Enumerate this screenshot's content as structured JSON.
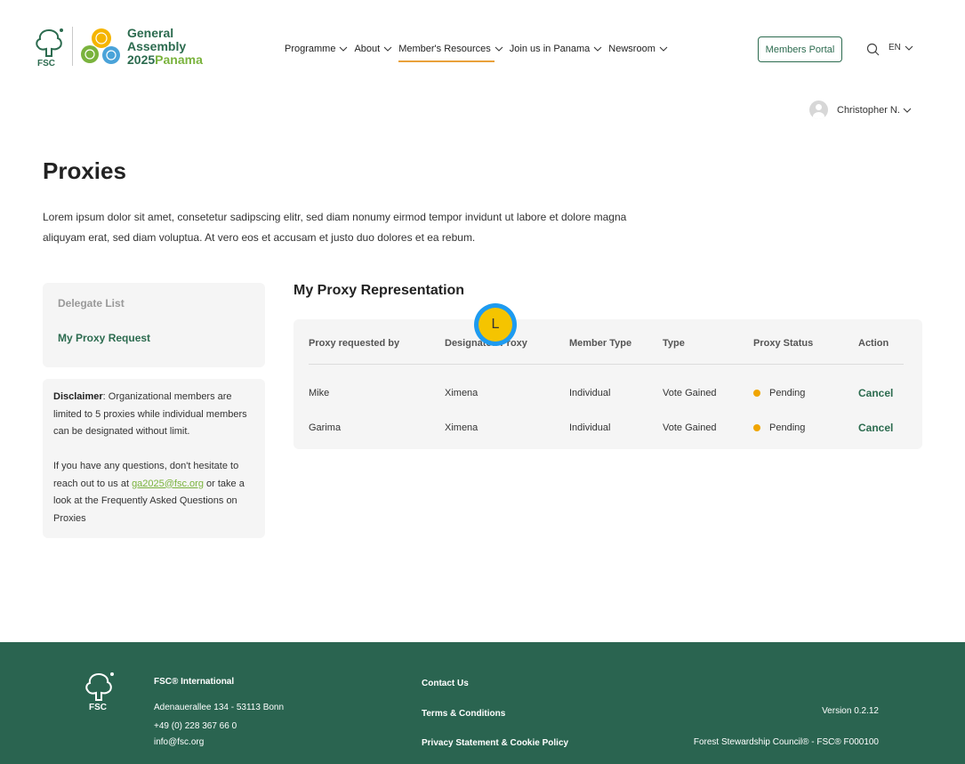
{
  "header": {
    "logo_text": "FSC",
    "ga_line1": "General",
    "ga_line2": "Assembly",
    "ga_year": "2025",
    "ga_place": "Panama",
    "nav": [
      {
        "label": "Programme",
        "icon": "chevron-down-icon"
      },
      {
        "label": "About",
        "icon": "chevron-down-icon"
      },
      {
        "label": "Member's Resources",
        "icon": "chevron-down-icon",
        "active": true
      },
      {
        "label": "Join us in Panama",
        "icon": "chevron-down-icon"
      },
      {
        "label": "Newsroom",
        "icon": "chevron-down-icon"
      }
    ],
    "members_portal": "Members Portal",
    "language": "EN",
    "user_name": "Christopher N."
  },
  "page": {
    "title": "Proxies",
    "description": "Lorem ipsum dolor sit amet, consetetur sadipscing elitr, sed diam nonumy eirmod tempor invidunt ut labore et dolore magna aliquyam erat, sed diam voluptua. At vero eos et accusam et justo duo dolores et ea rebum."
  },
  "sidebar": {
    "items": [
      {
        "label": "Delegate List"
      },
      {
        "label": "My Proxy Request"
      }
    ],
    "disclaimer_label": "Disclaimer",
    "disclaimer_text": ": Organizational members are limited to 5 proxies while individual members can be designated without limit.",
    "contact_prefix": "If you have any questions, don't hesitate to reach out to us at ",
    "contact_email": "ga2025@fsc.org",
    "contact_suffix": " or take a look at the Frequently Asked Questions on Proxies"
  },
  "table": {
    "title": "My Proxy Representation",
    "columns": [
      "Proxy requested by",
      "Designated Proxy",
      "Member Type",
      "Type",
      "Proxy Status",
      "Action"
    ],
    "rows": [
      {
        "requested_by": "Mike",
        "designated": "Ximena",
        "member_type": "Individual",
        "type": "Vote Gained",
        "status": "Pending",
        "action": "Cancel"
      },
      {
        "requested_by": "Garima",
        "designated": "Ximena",
        "member_type": "Individual",
        "type": "Vote Gained",
        "status": "Pending",
        "action": "Cancel"
      }
    ],
    "status_color": "#f0a500"
  },
  "cursor": {
    "label": "L"
  },
  "footer": {
    "org": "FSC® International",
    "address": "Adenauerallee 134 - 53113 Bonn",
    "phone": "+49 (0) 228 367 66 0",
    "email": "info@fsc.org",
    "links": [
      "Contact Us",
      "Terms & Conditions",
      "Privacy Statement & Cookie Policy"
    ],
    "version": "Version 0.2.12",
    "copyright": "Forest Stewardship Council® - FSC® F000100"
  },
  "colors": {
    "brand_green": "#2c6b4f",
    "accent_green": "#7ab33d",
    "accent_orange": "#e9a13a",
    "footer_bg": "#2a6450"
  }
}
